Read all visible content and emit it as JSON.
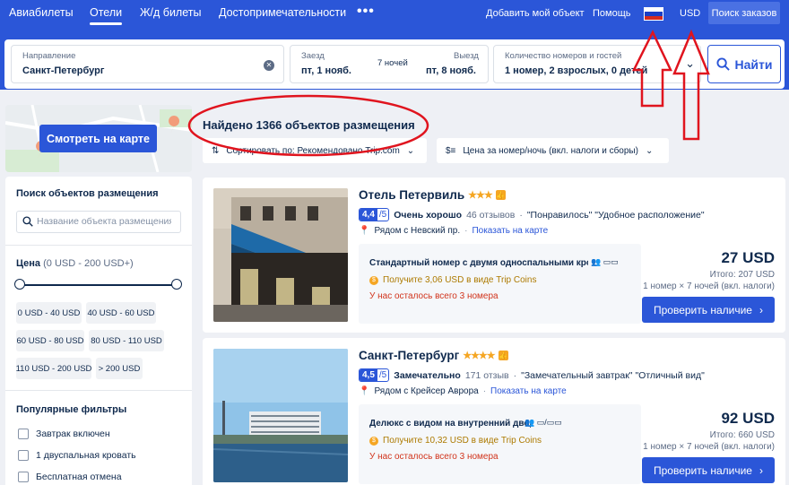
{
  "nav": {
    "items": [
      {
        "label": "Авиабилеты",
        "active": false
      },
      {
        "label": "Отели",
        "active": true
      },
      {
        "label": "Ж/д билеты",
        "active": false
      },
      {
        "label": "Достопримечательности",
        "active": false
      }
    ],
    "more": "•••",
    "add_property": "Добавить мой объект",
    "help": "Помощь",
    "currency": "USD",
    "orders": "Поиск заказов"
  },
  "search": {
    "destination_label": "Направление",
    "destination_value": "Санкт-Петербург",
    "checkin_label": "Заезд",
    "checkin_value": "пт, 1 нояб.",
    "nights": "7 ночей",
    "checkout_label": "Выезд",
    "checkout_value": "пт, 8 нояб.",
    "guests_label": "Количество номеров и гостей",
    "guests_value": "1 номер, 2 взрослых, 0 детей",
    "find_button": "Найти"
  },
  "left": {
    "map_button": "Смотреть на карте",
    "search_title": "Поиск объектов размещения",
    "search_placeholder": "Название объекта размещения",
    "price_title": "Цена",
    "price_range": "(0 USD - 200 USD+)",
    "price_chips": [
      "0 USD - 40 USD",
      "40 USD - 60 USD",
      "60 USD - 80 USD",
      "80 USD - 110 USD",
      "110 USD - 200 USD",
      "> 200 USD"
    ],
    "popular_title": "Популярные фильтры",
    "filters": [
      "Завтрак включен",
      "1 двуспальная кровать",
      "Бесплатная отмена"
    ]
  },
  "main": {
    "found": "Найдено 1366 объектов размещения",
    "sort": "Сортировать по: Рекомендовано Trip.com",
    "price_mode": "Цена за номер/ночь (вкл. налоги и сборы)",
    "hotels": [
      {
        "name": "Отель Петервиль",
        "stars": "★★★",
        "score": "4,4",
        "max": "/5",
        "rating_label": "Очень хорошо",
        "reviews": "46 отзывов",
        "tags": "\"Понравилось\"  \"Удобное расположение\"",
        "location": "Рядом с Невский пр.",
        "map_link": "Показать на карте",
        "room": "Стандартный номер с двумя односпальными кро...",
        "coins": "Получите 3,06 USD в виде Trip Coins",
        "left": "У нас осталось всего 3 номера",
        "price": "27 USD",
        "total": "Итого: 207 USD",
        "per": "1 номер × 7 ночей (вкл. налоги)",
        "button": "Проверить наличие"
      },
      {
        "name": "Санкт-Петербург",
        "stars": "★★★★",
        "score": "4,5",
        "max": "/5",
        "rating_label": "Замечательно",
        "reviews": "171 отзыв",
        "tags": "\"Замечательный завтрак\"  \"Отличный вид\"",
        "location": "Рядом с Крейсер Аврора",
        "map_link": "Показать на карте",
        "room": "Делюкс с видом на внутренний двор",
        "coins": "Получите 10,32 USD в виде Trip Coins",
        "left": "У нас осталось всего 3 номера",
        "price": "92 USD",
        "total": "Итого: 660 USD",
        "per": "1 номер × 7 ночей (вкл. налоги)",
        "button": "Проверить наличие"
      }
    ]
  },
  "colors": {
    "brand": "#2b56d8",
    "annotation": "#e0141e"
  }
}
